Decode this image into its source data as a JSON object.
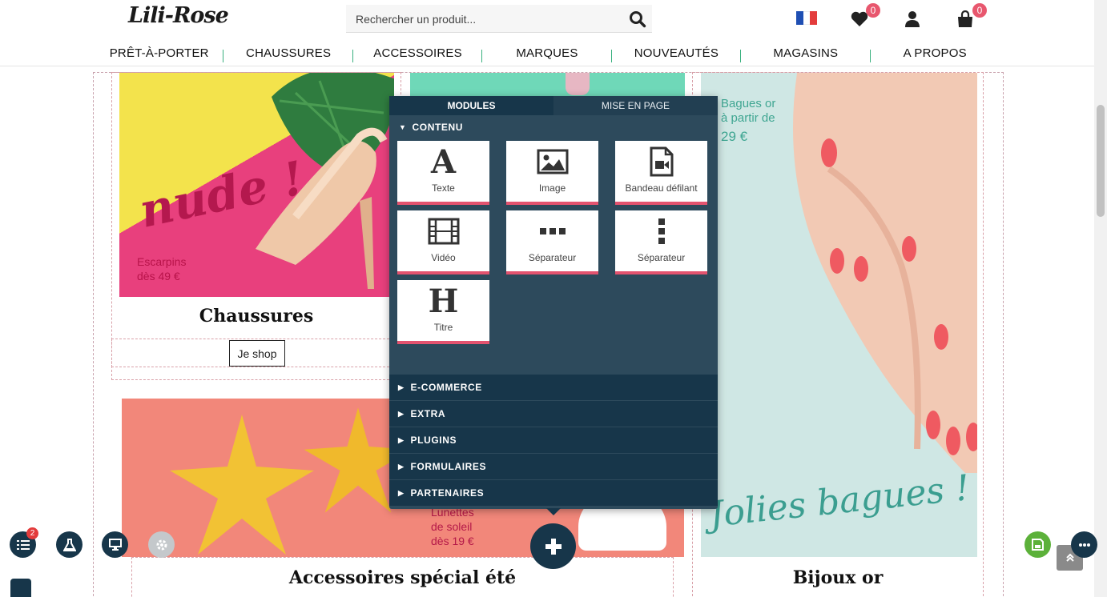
{
  "header": {
    "logo_text": "Lili-Rose",
    "search": {
      "placeholder": "Rechercher un produit..."
    },
    "wishlist_count": "0",
    "cart_count": "0",
    "nav": [
      "PRÊT-À-PORTER",
      "CHAUSSURES",
      "ACCESSOIRES",
      "MARQUES",
      "NOUVEAUTÉS",
      "MAGASINS",
      "A PROPOS"
    ]
  },
  "content": {
    "banner_shoes": {
      "script_text": "nude !",
      "promo_line1": "Escarpins",
      "promo_line2": "dès 49 €"
    },
    "caption_shoes": "Chaussures",
    "shop_button": "Je shop",
    "banner_rings": {
      "promo_line1": "Bagues or",
      "promo_line2": "à partir de",
      "promo_line3": "29 €",
      "script_text": "Jolies bagues !"
    },
    "banner_summer": {
      "promo_line1": "Lunettes",
      "promo_line2": "de soleil",
      "promo_line3": "dès 19 €"
    },
    "caption_summer": "Accessoires spécial été",
    "caption_rings": "Bijoux or"
  },
  "panel": {
    "tabs": [
      {
        "label": "MODULES",
        "active": true
      },
      {
        "label": "MISE EN PAGE",
        "active": false
      }
    ],
    "open_section": "CONTENU",
    "modules": [
      {
        "label": "Texte",
        "icon": "text-a-icon"
      },
      {
        "label": "Image",
        "icon": "image-icon"
      },
      {
        "label": "Bandeau défilant",
        "icon": "video-file-icon"
      },
      {
        "label": "Vidéo",
        "icon": "film-icon"
      },
      {
        "label": "Séparateur",
        "icon": "dots-horizontal-icon"
      },
      {
        "label": "Séparateur",
        "icon": "dots-vertical-icon"
      },
      {
        "label": "Titre",
        "icon": "heading-h-icon"
      }
    ],
    "categories": [
      "E-COMMERCE",
      "EXTRA",
      "PLUGINS",
      "FORMULAIRES",
      "PARTENAIRES"
    ]
  },
  "toolbar": {
    "layers_badge": "2"
  },
  "colors": {
    "accent_pink": "#e3536f",
    "panel_bg": "#2d4a5c",
    "panel_dark": "#17364a",
    "save_green": "#5cb13a",
    "nav_divider": "#38b07e"
  }
}
